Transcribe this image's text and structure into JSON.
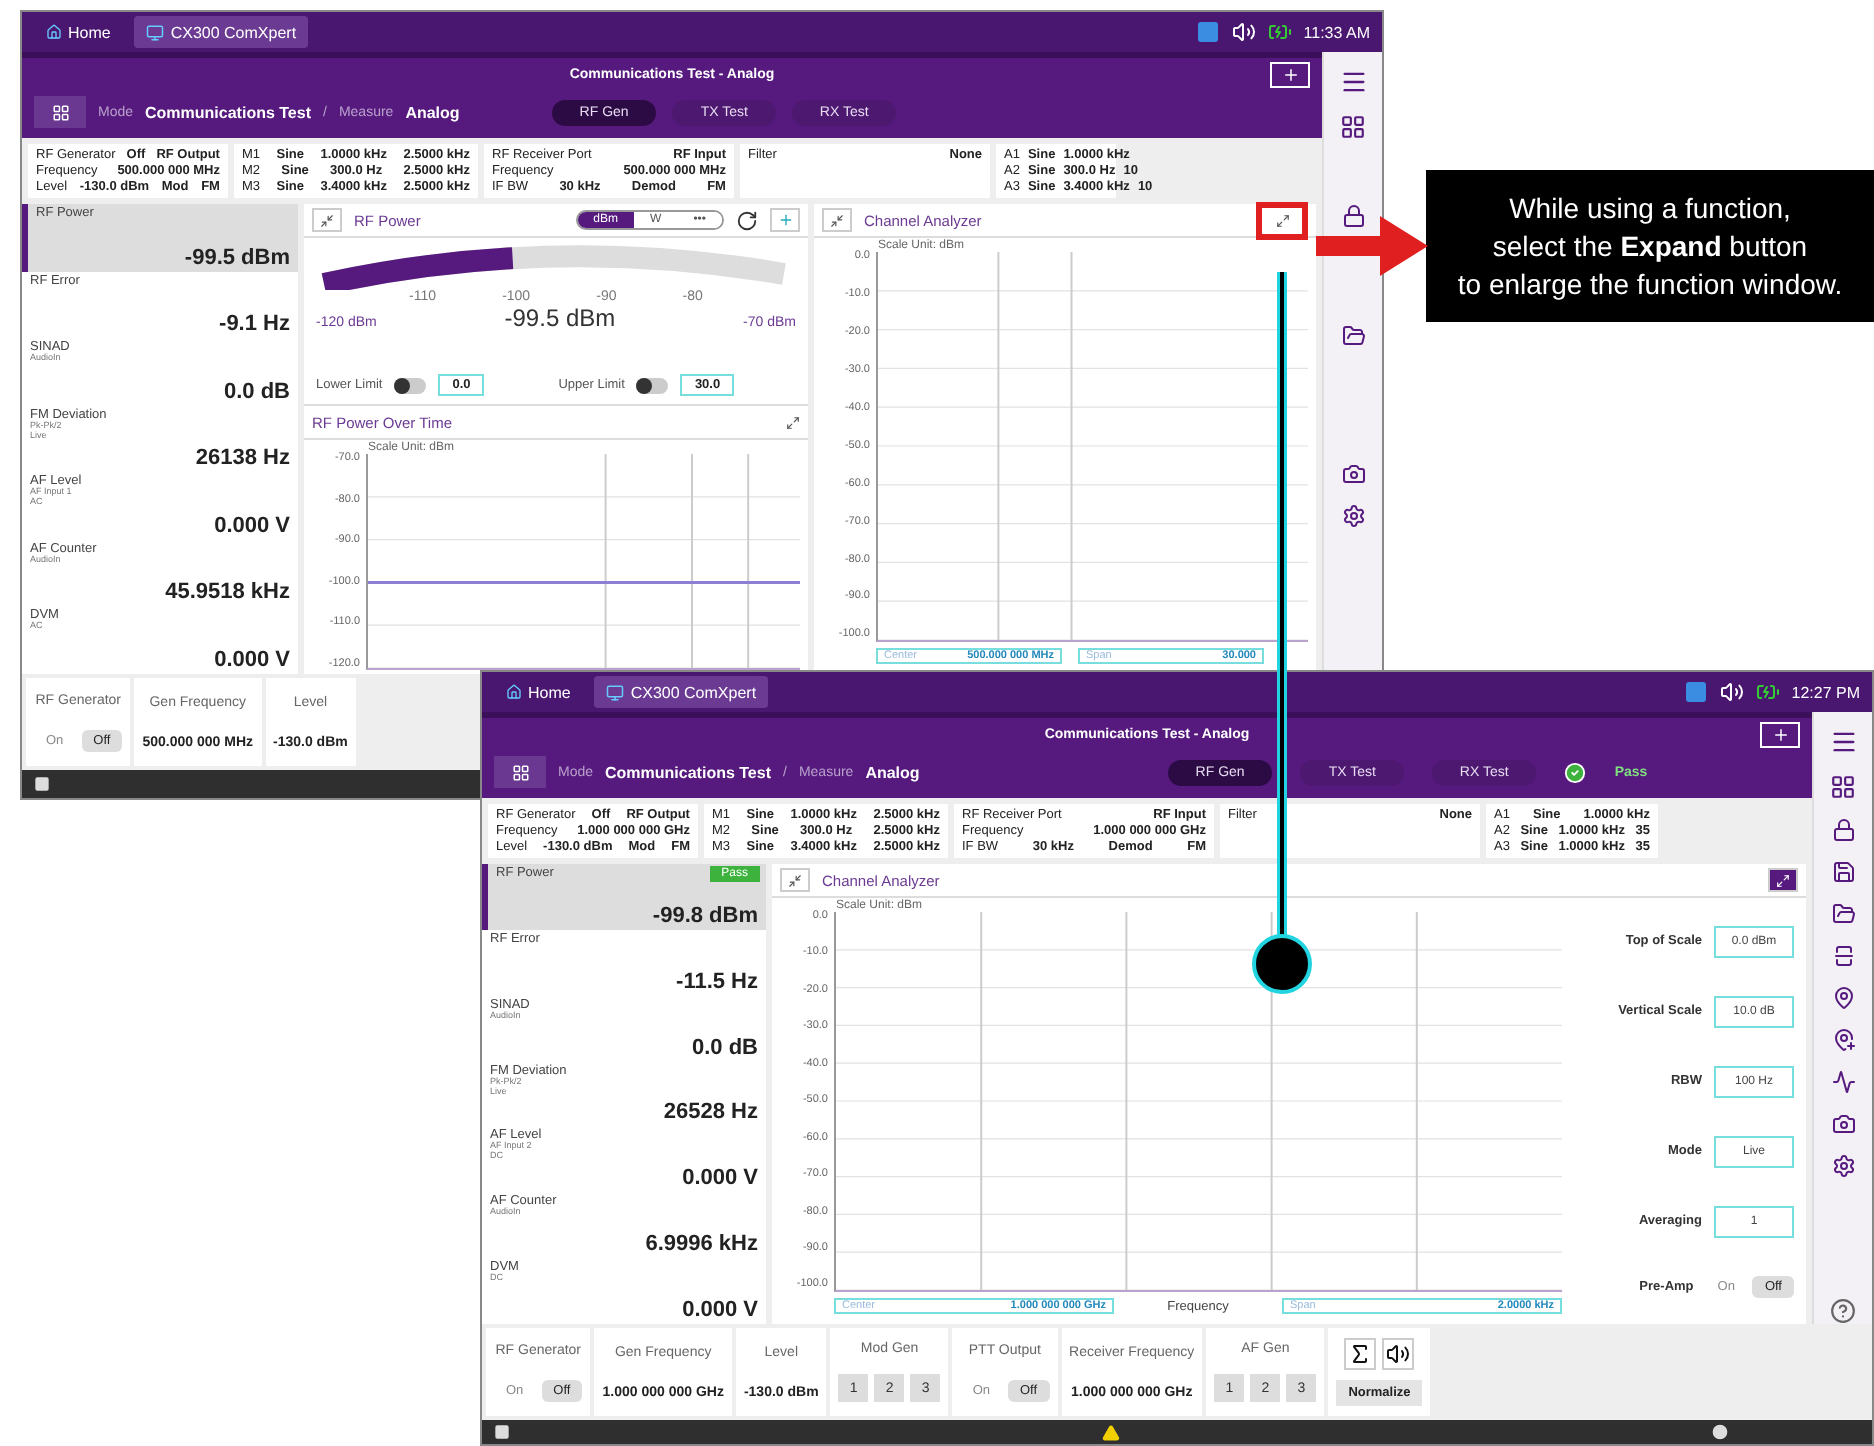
{
  "callout": {
    "lines": [
      "While using a function,",
      "select the **Expand** button",
      "to enlarge the function window."
    ]
  },
  "screens": [
    {
      "kind": "overview",
      "top_bar": {
        "tabs": [
          {
            "label": "Home",
            "selected": false
          },
          {
            "label": "CX300 ComXpert",
            "selected": true
          }
        ],
        "time": "11:33 AM"
      },
      "header": {
        "title": "Communications Test - Analog",
        "mode_label": "Mode",
        "mode": "Communications Test",
        "separator": "/",
        "measure_label": "Measure",
        "measure": "Analog",
        "tabs": [
          {
            "label": "RF Gen",
            "selected": true
          },
          {
            "label": "TX Test",
            "selected": false
          },
          {
            "label": "RX Test",
            "selected": false
          }
        ]
      },
      "info_columns": [
        {
          "rows": [
            [
              "RF Generator",
              "Off",
              "RF Output"
            ],
            [
              "Frequency",
              "500.000 000 MHz"
            ],
            [
              "Level",
              "-130.0 dBm",
              "Mod",
              "FM"
            ]
          ]
        },
        {
          "rows": [
            [
              "M1",
              "Sine",
              "1.0000 kHz",
              "2.5000 kHz"
            ],
            [
              "M2",
              "Sine",
              "300.0 Hz",
              "2.5000 kHz"
            ],
            [
              "M3",
              "Sine",
              "3.4000 kHz",
              "2.5000 kHz"
            ]
          ]
        },
        {
          "rows": [
            [
              "RF Receiver Port",
              "RF Input"
            ],
            [
              "Frequency",
              "500.000 000 MHz"
            ],
            [
              "IF BW",
              "30 kHz",
              "Demod",
              "FM"
            ]
          ]
        },
        {
          "rows": [
            [
              "Filter",
              "None"
            ]
          ]
        },
        {
          "rows": [
            [
              "A1",
              "Sine",
              "1.0000 kHz"
            ],
            [
              "A2",
              "Sine",
              "300.0 Hz",
              "10"
            ],
            [
              "A3",
              "Sine",
              "3.4000 kHz",
              "10"
            ]
          ]
        }
      ],
      "measurements": [
        {
          "name": "RF Power",
          "value": "-99.5 dBm",
          "selected": true
        },
        {
          "name": "RF Error",
          "value": "-9.1 Hz",
          "selected": false
        },
        {
          "name": "SINAD",
          "details": [
            "AudioIn"
          ],
          "value": "0.0 dB",
          "selected": false
        },
        {
          "name": "FM Deviation",
          "details": [
            "Pk-Pk/2",
            "Live"
          ],
          "value": "26138 Hz",
          "selected": false
        },
        {
          "name": "AF Level",
          "details": [
            "AF Input 1",
            "AC"
          ],
          "value": "0.000 V",
          "selected": false
        },
        {
          "name": "AF Counter",
          "details": [
            "AudioIn"
          ],
          "value": "45.9518 kHz",
          "selected": false
        },
        {
          "name": "DVM",
          "details": [
            "AC"
          ],
          "value": "0.000 V",
          "selected": false
        }
      ],
      "rf_power": {
        "title": "RF Power",
        "units": [
          {
            "label": "dBm",
            "selected": true
          },
          {
            "label": "W",
            "selected": false
          },
          {
            "label": "•••",
            "selected": false
          }
        ],
        "level": 0.41,
        "scale_ticks": [
          "-110",
          "-100",
          "-90",
          "-80"
        ],
        "min_label": "-120 dBm",
        "reading": "-99.5 dBm",
        "max_label": "-70 dBm",
        "limits": [
          {
            "label": "Lower Limit",
            "on": false,
            "value": "0.0"
          },
          {
            "label": "Upper Limit",
            "on": false,
            "value": "30.0"
          }
        ],
        "over_time": {
          "title": "RF Power Over Time",
          "scale_unit": "Scale Unit: dBm",
          "y_ticks": [
            "-70.0",
            "-80.0",
            "-90.0",
            "-100.0",
            "-110.0",
            "-120.0"
          ]
        }
      },
      "analyzer": {
        "title": "Channel Analyzer",
        "expanded": false,
        "highlighted": true,
        "scale_unit": "Scale Unit: dBm",
        "y_ticks": [
          "0.0",
          "-10.0",
          "-20.0",
          "-30.0",
          "-40.0",
          "-50.0",
          "-60.0",
          "-70.0",
          "-80.0",
          "-90.0",
          "-100.0"
        ],
        "center_label": "Center",
        "center": "500.000 000 MHz",
        "span_label": "Span",
        "span": "30.000"
      },
      "bottom_bar": [
        {
          "kind": "toggle",
          "title": "RF Generator",
          "options": [
            {
              "label": "On",
              "selected": false
            },
            {
              "label": "Off",
              "selected": true
            }
          ]
        },
        {
          "kind": "value",
          "title": "Gen Frequency",
          "value": "500.000 000 MHz"
        },
        {
          "kind": "value",
          "title": "Level",
          "value": "-130.0 dBm"
        }
      ]
    },
    {
      "kind": "expanded",
      "top_bar": {
        "tabs": [
          {
            "label": "Home",
            "selected": false
          },
          {
            "label": "CX300 ComXpert",
            "selected": true
          }
        ],
        "time": "12:27 PM"
      },
      "header": {
        "title": "Communications Test - Analog",
        "mode_label": "Mode",
        "mode": "Communications Test",
        "separator": "/",
        "measure_label": "Measure",
        "measure": "Analog",
        "tabs": [
          {
            "label": "RF Gen",
            "selected": true
          },
          {
            "label": "TX Test",
            "selected": false
          },
          {
            "label": "RX Test",
            "selected": false
          }
        ],
        "pass": "Pass"
      },
      "info_columns": [
        {
          "rows": [
            [
              "RF Generator",
              "Off",
              "RF Output"
            ],
            [
              "Frequency",
              "1.000 000 000 GHz"
            ],
            [
              "Level",
              "-130.0 dBm",
              "Mod",
              "FM"
            ]
          ]
        },
        {
          "rows": [
            [
              "M1",
              "Sine",
              "1.0000 kHz",
              "2.5000 kHz"
            ],
            [
              "M2",
              "Sine",
              "300.0 Hz",
              "2.5000 kHz"
            ],
            [
              "M3",
              "Sine",
              "3.4000 kHz",
              "2.5000 kHz"
            ]
          ]
        },
        {
          "rows": [
            [
              "RF Receiver Port",
              "RF Input"
            ],
            [
              "Frequency",
              "1.000 000 000 GHz"
            ],
            [
              "IF BW",
              "30 kHz",
              "Demod",
              "FM"
            ]
          ]
        },
        {
          "rows": [
            [
              "Filter",
              "None"
            ]
          ]
        },
        {
          "rows": [
            [
              "A1",
              "Sine",
              "1.0000 kHz"
            ],
            [
              "A2",
              "Sine",
              "1.0000 kHz",
              "35"
            ],
            [
              "A3",
              "Sine",
              "1.0000 kHz",
              "35"
            ]
          ]
        }
      ],
      "measurements": [
        {
          "name": "RF Power",
          "value": "-99.8 dBm",
          "selected": true,
          "badge": "Pass"
        },
        {
          "name": "RF Error",
          "value": "-11.5 Hz",
          "selected": false
        },
        {
          "name": "SINAD",
          "details": [
            "AudioIn"
          ],
          "value": "0.0 dB",
          "selected": false
        },
        {
          "name": "FM Deviation",
          "details": [
            "Pk-Pk/2",
            "Live"
          ],
          "value": "26528 Hz",
          "selected": false
        },
        {
          "name": "AF Level",
          "details": [
            "AF Input 2",
            "DC"
          ],
          "value": "0.000 V",
          "selected": false
        },
        {
          "name": "AF Counter",
          "details": [
            "AudioIn"
          ],
          "value": "6.9996 kHz",
          "selected": false
        },
        {
          "name": "DVM",
          "details": [
            "DC"
          ],
          "value": "0.000 V",
          "selected": false
        }
      ],
      "analyzer": {
        "title": "Channel Analyzer",
        "expanded": true,
        "highlighted": false,
        "scale_unit": "Scale Unit: dBm",
        "y_ticks": [
          "0.0",
          "-10.0",
          "-20.0",
          "-30.0",
          "-40.0",
          "-50.0",
          "-60.0",
          "-70.0",
          "-80.0",
          "-90.0",
          "-100.0"
        ],
        "center_label": "Center",
        "center": "1.000 000 000 GHz",
        "x_label": "Frequency",
        "span_label": "Span",
        "span": "2.0000 kHz",
        "settings": [
          {
            "kind": "field",
            "label": "Top of Scale",
            "value": "0.0 dBm"
          },
          {
            "kind": "field",
            "label": "Vertical Scale",
            "value": "10.0 dB"
          },
          {
            "kind": "field",
            "label": "RBW",
            "value": "100 Hz"
          },
          {
            "kind": "field",
            "label": "Mode",
            "value": "Live"
          },
          {
            "kind": "field",
            "label": "Averaging",
            "value": "1"
          },
          {
            "kind": "toggle",
            "label": "Pre-Amp",
            "options": [
              {
                "label": "On",
                "selected": false
              },
              {
                "label": "Off",
                "selected": true
              }
            ]
          }
        ]
      },
      "bottom_bar": [
        {
          "kind": "toggle",
          "title": "RF Generator",
          "options": [
            {
              "label": "On",
              "selected": false
            },
            {
              "label": "Off",
              "selected": true
            }
          ]
        },
        {
          "kind": "value",
          "title": "Gen Frequency",
          "value": "1.000 000 000 GHz"
        },
        {
          "kind": "value",
          "title": "Level",
          "value": "-130.0 dBm"
        },
        {
          "kind": "numbers",
          "title": "Mod Gen",
          "options": [
            {
              "label": "1",
              "selected": false
            },
            {
              "label": "2",
              "selected": false
            },
            {
              "label": "3",
              "selected": false
            }
          ]
        },
        {
          "kind": "toggle",
          "title": "PTT Output",
          "options": [
            {
              "label": "On",
              "selected": false
            },
            {
              "label": "Off",
              "selected": true
            }
          ]
        },
        {
          "kind": "value",
          "title": "Receiver Frequency",
          "value": "1.000 000 000 GHz"
        },
        {
          "kind": "numbers",
          "title": "AF Gen",
          "options": [
            {
              "label": "1",
              "selected": false
            },
            {
              "label": "2",
              "selected": false
            },
            {
              "label": "3",
              "selected": false
            }
          ]
        },
        {
          "kind": "tools",
          "action": "Normalize"
        }
      ]
    }
  ]
}
